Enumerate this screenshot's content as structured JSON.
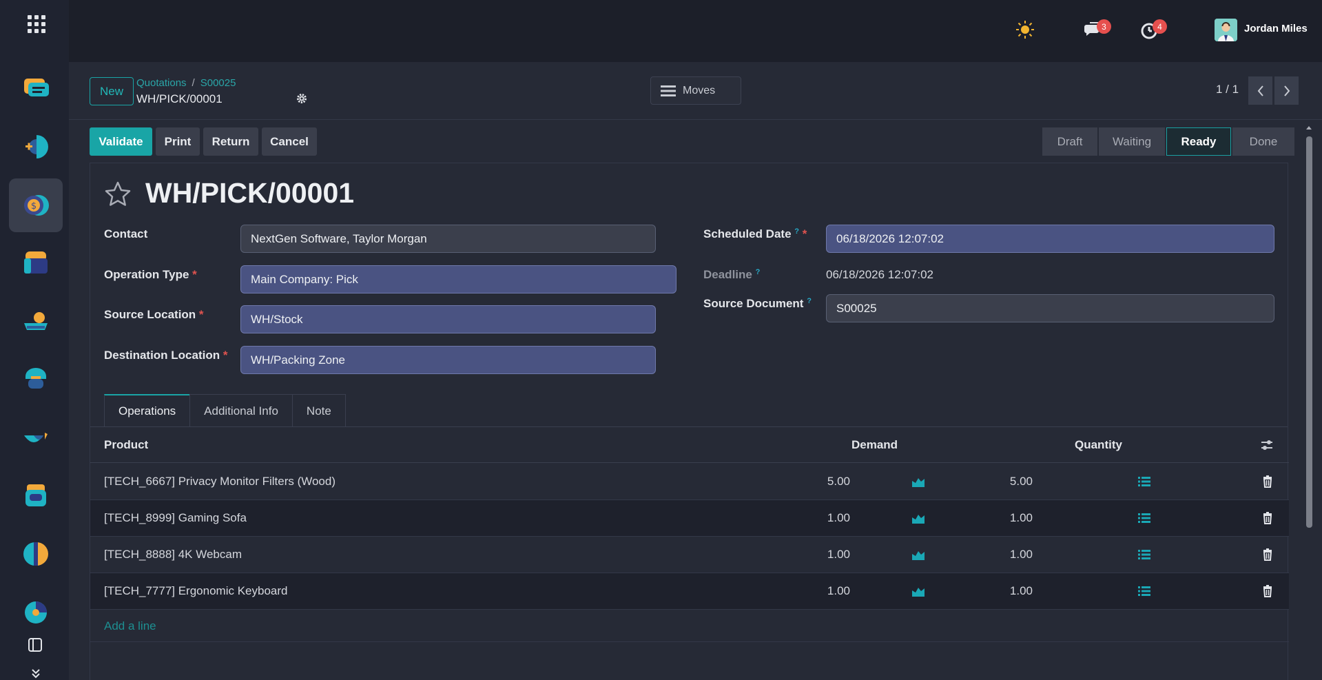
{
  "topbar": {
    "user_name": "Jordan Miles",
    "messages_count": "3",
    "activities_count": "4"
  },
  "control": {
    "new_label": "New",
    "breadcrumb_parent": "Quotations",
    "breadcrumb_child": "S00025",
    "breadcrumb_sep": "/",
    "record_name": "WH/PICK/00001",
    "moves_label": "Moves",
    "pager": "1 / 1"
  },
  "actions": {
    "validate": "Validate",
    "print": "Print",
    "return": "Return",
    "cancel": "Cancel"
  },
  "statusbar": {
    "stages": [
      "Draft",
      "Waiting",
      "Ready",
      "Done"
    ],
    "current": "Ready"
  },
  "form": {
    "title": "WH/PICK/00001",
    "contact_label": "Contact",
    "contact_value": "NextGen Software, Taylor Morgan",
    "operation_type_label": "Operation Type",
    "operation_type_value": "Main Company: Pick",
    "source_location_label": "Source Location",
    "source_location_value": "WH/Stock",
    "destination_location_label": "Destination Location",
    "destination_location_value": "WH/Packing Zone",
    "scheduled_date_label": "Scheduled Date",
    "scheduled_date_value": "06/18/2026 12:07:02",
    "deadline_label": "Deadline",
    "deadline_value": "06/18/2026 12:07:02",
    "source_document_label": "Source Document",
    "source_document_value": "S00025",
    "required_mark": "*",
    "help_mark": "?"
  },
  "tabs": [
    "Operations",
    "Additional Info",
    "Note"
  ],
  "table": {
    "headers": {
      "product": "Product",
      "demand": "Demand",
      "quantity": "Quantity"
    },
    "rows": [
      {
        "product": "[TECH_6667] Privacy Monitor Filters (Wood)",
        "demand": "5.00",
        "quantity": "5.00"
      },
      {
        "product": "[TECH_8999] Gaming Sofa",
        "demand": "1.00",
        "quantity": "1.00"
      },
      {
        "product": "[TECH_8888] 4K Webcam",
        "demand": "1.00",
        "quantity": "1.00"
      },
      {
        "product": "[TECH_7777] Ergonomic Keyboard",
        "demand": "1.00",
        "quantity": "1.00"
      }
    ],
    "add_line": "Add a line"
  },
  "colors": {
    "accent": "#19a5a6",
    "badge": "#e6504e",
    "field_highlight": "#4a5382"
  }
}
